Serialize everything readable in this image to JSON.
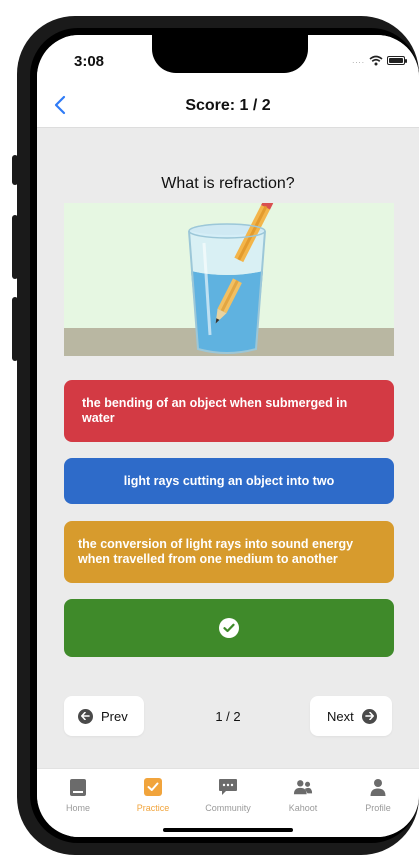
{
  "status_bar": {
    "time": "3:08",
    "signal_dots": "....",
    "icons": [
      "wifi-icon",
      "battery-icon"
    ]
  },
  "navbar": {
    "back_icon": "chevron-left-icon",
    "title": "Score: 1 / 2"
  },
  "question": {
    "text": "What is refraction?",
    "image": "glass-of-water-with-pencil"
  },
  "answers": [
    {
      "text": "the bending of an object when submerged in water",
      "color": "#d33a44"
    },
    {
      "text": "light rays cutting an object into two",
      "color": "#2e6bc9"
    },
    {
      "text": "the conversion of light rays into sound energy when travelled from one medium to another",
      "color": "#d79b2d"
    },
    {
      "text": "",
      "color": "#3f8a2a",
      "icon": "check-circle-icon",
      "state": "correct-selected"
    }
  ],
  "pager": {
    "prev_label": "Prev",
    "next_label": "Next",
    "page": "1 / 2"
  },
  "tabs": [
    {
      "label": "Home",
      "icon": "home-icon",
      "active": false
    },
    {
      "label": "Practice",
      "icon": "check-square-icon",
      "active": true
    },
    {
      "label": "Community",
      "icon": "chat-icon",
      "active": false
    },
    {
      "label": "Kahoot",
      "icon": "people-icon",
      "active": false
    },
    {
      "label": "Profile",
      "icon": "person-icon",
      "active": false
    }
  ],
  "colors": {
    "accent": "#f1a43c",
    "link": "#2f7bf6",
    "background": "#ebebeb"
  }
}
